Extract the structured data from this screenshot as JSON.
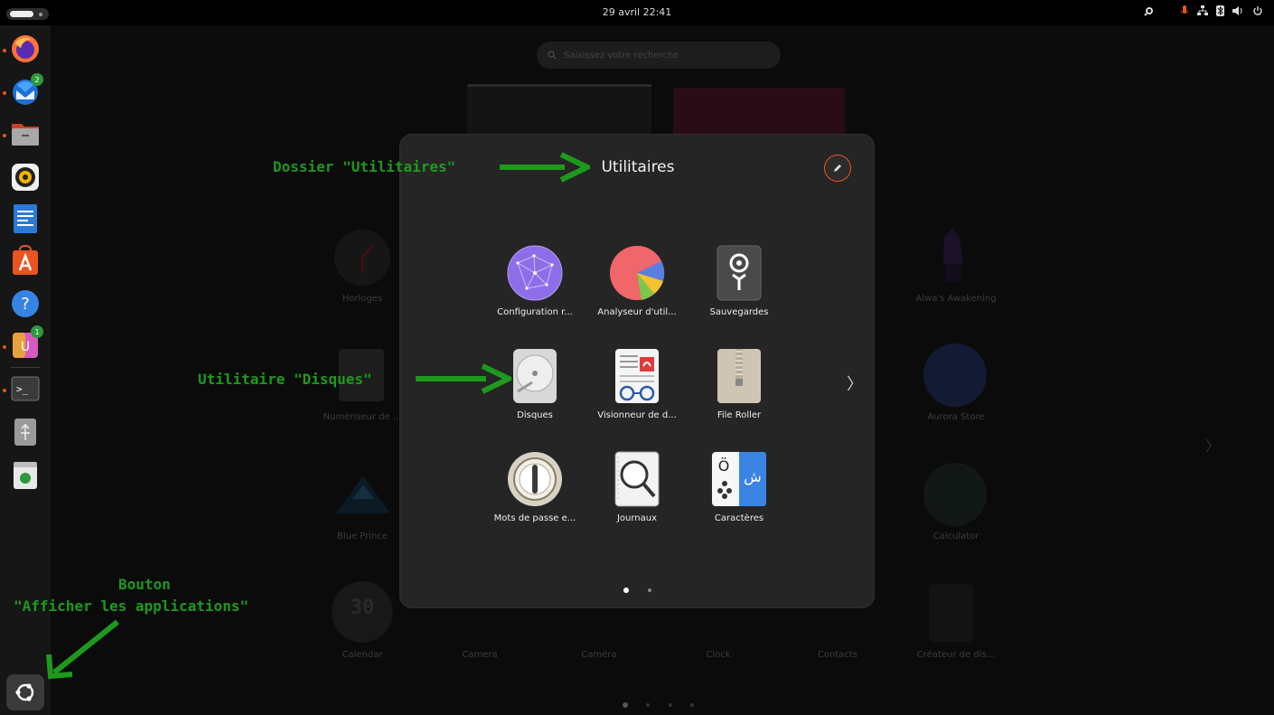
{
  "topbar": {
    "clock": "29 avril  22:41",
    "tray_icons": [
      "settings-icon",
      "mic-icon",
      "network-icon",
      "bluetooth-icon",
      "volume-icon",
      "power-icon"
    ]
  },
  "dock": {
    "items": [
      {
        "name": "firefox",
        "running": true
      },
      {
        "name": "thunderbird",
        "running": true,
        "badge": "2"
      },
      {
        "name": "files",
        "running": true
      },
      {
        "name": "rhythmbox",
        "running": false
      },
      {
        "name": "libreoffice-writer",
        "running": false
      },
      {
        "name": "app-center",
        "running": false
      },
      {
        "name": "help",
        "running": false
      },
      {
        "name": "unicode-app",
        "running": true,
        "badge": "1"
      },
      {
        "name": "terminal",
        "running": true
      },
      {
        "name": "usb-drive",
        "running": false
      },
      {
        "name": "trash",
        "running": false
      }
    ],
    "show_apps_label": "Afficher les applications"
  },
  "overview": {
    "search_placeholder": "Saisissez votre recherche",
    "background_apps": {
      "horloges": "Horloges",
      "numeriseur": "Numériseur de ...",
      "blue_prince": "Blue Prince",
      "alwa": "Alwa's Awakening",
      "aurora": "Aurora Store",
      "calculator": "Calculator",
      "calendar": "Calendar",
      "camera": "Camera",
      "camera_fr": "Caméra",
      "clock": "Clock",
      "contacts": "Contacts",
      "createur": "Créateur de dis..."
    },
    "calendar_day": "30"
  },
  "folder": {
    "title": "Utilitaires",
    "apps": [
      {
        "label": "Configuration r...",
        "icon": "network-config-icon"
      },
      {
        "label": "Analyseur d'util...",
        "icon": "disk-usage-pie-icon"
      },
      {
        "label": "Sauvegardes",
        "icon": "backup-safe-icon"
      },
      {
        "label": "Disques",
        "icon": "disks-icon"
      },
      {
        "label": "Visionneur de d...",
        "icon": "document-viewer-icon"
      },
      {
        "label": "File Roller",
        "icon": "archive-zipper-icon"
      },
      {
        "label": "Mots de passe e...",
        "icon": "passwords-keys-icon"
      },
      {
        "label": "Journaux",
        "icon": "logs-magnifier-icon"
      },
      {
        "label": "Caractères",
        "icon": "characters-icon"
      }
    ],
    "page": 1,
    "page_count": 2
  },
  "annotations": {
    "folder": "Dossier \"Utilitaires\"",
    "disks": "Utilitaire \"Disques\"",
    "button_line1": "Bouton",
    "button_line2": "\"Afficher les applications\""
  },
  "colors": {
    "accent": "#e95420",
    "annotation": "#1d9a1d",
    "folder_bg": "#252525"
  }
}
